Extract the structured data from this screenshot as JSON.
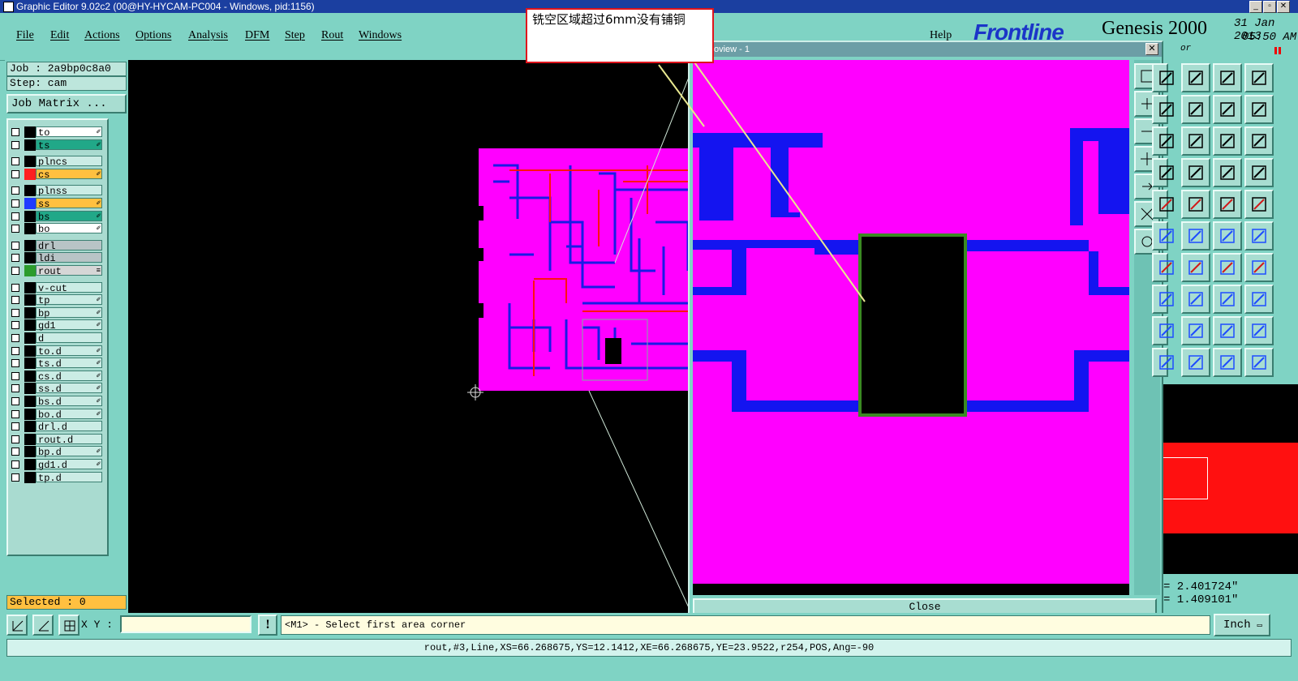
{
  "window": {
    "title": "Graphic Editor 9.02c2 (00@HY-HYCAM-PC004 - Windows, pid:1156)",
    "controls": {
      "minimize": "_",
      "restore": "▫",
      "close": "✕"
    }
  },
  "menu": {
    "items": [
      "File",
      "Edit",
      "Actions",
      "Options",
      "Analysis",
      "DFM",
      "Step",
      "Rout",
      "Windows"
    ],
    "help": "Help"
  },
  "brand": {
    "logo": "Frontline",
    "product": "Genesis 2000",
    "date": "31 Jan 2013",
    "time": "05:50 AM",
    "subtitle": "or"
  },
  "left_panel": {
    "job": "Job : 2a9bp0c8a0",
    "step": "Step: cam",
    "job_matrix_button": "Job Matrix ...",
    "selected": "Selected : 0",
    "layers": [
      {
        "name": "to",
        "color": "#000000",
        "bg": "#ffffff",
        "edit": "✐"
      },
      {
        "name": "ts",
        "color": "#000000",
        "bg": "#21a888",
        "edit": "✐"
      },
      {
        "name": "plncs",
        "color": "#000000",
        "bg": "#cbece5",
        "edit": ""
      },
      {
        "name": "cs",
        "color": "#ff2020",
        "bg": "#ffc040",
        "edit": "✐"
      },
      {
        "name": "plnss",
        "color": "#000000",
        "bg": "#cbece5",
        "edit": ""
      },
      {
        "name": "ss",
        "color": "#1f3bff",
        "bg": "#ffc040",
        "edit": "✐"
      },
      {
        "name": "bs",
        "color": "#000000",
        "bg": "#21a888",
        "edit": "✐"
      },
      {
        "name": "bo",
        "color": "#000000",
        "bg": "#ffffff",
        "edit": "✐"
      },
      {
        "name": "drl",
        "color": "#000000",
        "bg": "#b8c4c6",
        "edit": ""
      },
      {
        "name": "ldi",
        "color": "#000000",
        "bg": "#b8c4c6",
        "edit": ""
      },
      {
        "name": "rout",
        "color": "#2c9c2c",
        "bg": "#d6d6d6",
        "edit": "≡"
      },
      {
        "name": "v-cut",
        "color": "#000000",
        "bg": "#cbece5",
        "edit": ""
      },
      {
        "name": "tp",
        "color": "#000000",
        "bg": "#cbece5",
        "edit": "✐"
      },
      {
        "name": "bp",
        "color": "#000000",
        "bg": "#cbece5",
        "edit": "✐"
      },
      {
        "name": "gd1",
        "color": "#000000",
        "bg": "#cbece5",
        "edit": "✐"
      },
      {
        "name": "d",
        "color": "#000000",
        "bg": "#cbece5",
        "edit": ""
      },
      {
        "name": "to.d",
        "color": "#000000",
        "bg": "#cbece5",
        "edit": "✐"
      },
      {
        "name": "ts.d",
        "color": "#000000",
        "bg": "#cbece5",
        "edit": "✐"
      },
      {
        "name": "cs.d",
        "color": "#000000",
        "bg": "#cbece5",
        "edit": "✐"
      },
      {
        "name": "ss.d",
        "color": "#000000",
        "bg": "#cbece5",
        "edit": "✐"
      },
      {
        "name": "bs.d",
        "color": "#000000",
        "bg": "#cbece5",
        "edit": "✐"
      },
      {
        "name": "bo.d",
        "color": "#000000",
        "bg": "#cbece5",
        "edit": "✐"
      },
      {
        "name": "drl.d",
        "color": "#000000",
        "bg": "#cbece5",
        "edit": ""
      },
      {
        "name": "rout.d",
        "color": "#000000",
        "bg": "#cbece5",
        "edit": ""
      },
      {
        "name": "bp.d",
        "color": "#000000",
        "bg": "#cbece5",
        "edit": "✐"
      },
      {
        "name": "gd1.d",
        "color": "#000000",
        "bg": "#cbece5",
        "edit": "✐"
      },
      {
        "name": "tp.d",
        "color": "#000000",
        "bg": "#cbece5",
        "edit": ""
      }
    ]
  },
  "zoom_window": {
    "title": "oview - 1",
    "close_button": "Close",
    "close_x": "✕"
  },
  "callout": {
    "text": "铣空区域超过6mm没有铺铜"
  },
  "coords": {
    "x": "= 2.401724\"",
    "y": "= 1.409101\""
  },
  "units": "Inch",
  "command": {
    "xy_label": "X Y :",
    "xy_value": "",
    "prompt": "<M1> - Select first area corner",
    "warn": "!"
  },
  "status": "rout,#3,Line,XS=66.268675,YS=12.1412,XE=66.268675,YE=23.9522,r254,POS,Ang=-90",
  "colors": {
    "copper": "#ff00ff",
    "trace": "#0000ff",
    "signal": "#ff0000",
    "rout": "#2c8a20",
    "bg": "#000000",
    "panel": "#7fd3c4"
  }
}
